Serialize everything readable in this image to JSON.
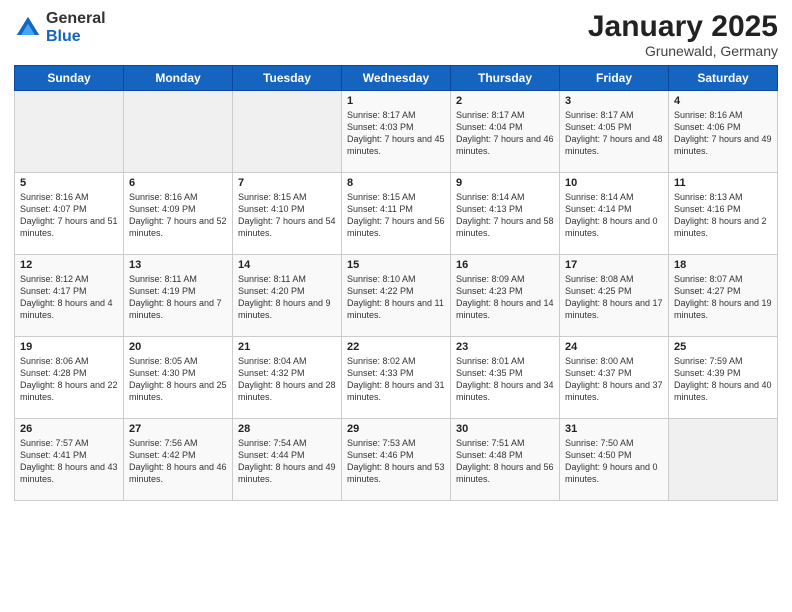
{
  "header": {
    "logo_general": "General",
    "logo_blue": "Blue",
    "month_title": "January 2025",
    "location": "Grunewald, Germany"
  },
  "days_of_week": [
    "Sunday",
    "Monday",
    "Tuesday",
    "Wednesday",
    "Thursday",
    "Friday",
    "Saturday"
  ],
  "weeks": [
    [
      {
        "day": "",
        "content": ""
      },
      {
        "day": "",
        "content": ""
      },
      {
        "day": "",
        "content": ""
      },
      {
        "day": "1",
        "content": "Sunrise: 8:17 AM\nSunset: 4:03 PM\nDaylight: 7 hours and 45 minutes."
      },
      {
        "day": "2",
        "content": "Sunrise: 8:17 AM\nSunset: 4:04 PM\nDaylight: 7 hours and 46 minutes."
      },
      {
        "day": "3",
        "content": "Sunrise: 8:17 AM\nSunset: 4:05 PM\nDaylight: 7 hours and 48 minutes."
      },
      {
        "day": "4",
        "content": "Sunrise: 8:16 AM\nSunset: 4:06 PM\nDaylight: 7 hours and 49 minutes."
      }
    ],
    [
      {
        "day": "5",
        "content": "Sunrise: 8:16 AM\nSunset: 4:07 PM\nDaylight: 7 hours and 51 minutes."
      },
      {
        "day": "6",
        "content": "Sunrise: 8:16 AM\nSunset: 4:09 PM\nDaylight: 7 hours and 52 minutes."
      },
      {
        "day": "7",
        "content": "Sunrise: 8:15 AM\nSunset: 4:10 PM\nDaylight: 7 hours and 54 minutes."
      },
      {
        "day": "8",
        "content": "Sunrise: 8:15 AM\nSunset: 4:11 PM\nDaylight: 7 hours and 56 minutes."
      },
      {
        "day": "9",
        "content": "Sunrise: 8:14 AM\nSunset: 4:13 PM\nDaylight: 7 hours and 58 minutes."
      },
      {
        "day": "10",
        "content": "Sunrise: 8:14 AM\nSunset: 4:14 PM\nDaylight: 8 hours and 0 minutes."
      },
      {
        "day": "11",
        "content": "Sunrise: 8:13 AM\nSunset: 4:16 PM\nDaylight: 8 hours and 2 minutes."
      }
    ],
    [
      {
        "day": "12",
        "content": "Sunrise: 8:12 AM\nSunset: 4:17 PM\nDaylight: 8 hours and 4 minutes."
      },
      {
        "day": "13",
        "content": "Sunrise: 8:11 AM\nSunset: 4:19 PM\nDaylight: 8 hours and 7 minutes."
      },
      {
        "day": "14",
        "content": "Sunrise: 8:11 AM\nSunset: 4:20 PM\nDaylight: 8 hours and 9 minutes."
      },
      {
        "day": "15",
        "content": "Sunrise: 8:10 AM\nSunset: 4:22 PM\nDaylight: 8 hours and 11 minutes."
      },
      {
        "day": "16",
        "content": "Sunrise: 8:09 AM\nSunset: 4:23 PM\nDaylight: 8 hours and 14 minutes."
      },
      {
        "day": "17",
        "content": "Sunrise: 8:08 AM\nSunset: 4:25 PM\nDaylight: 8 hours and 17 minutes."
      },
      {
        "day": "18",
        "content": "Sunrise: 8:07 AM\nSunset: 4:27 PM\nDaylight: 8 hours and 19 minutes."
      }
    ],
    [
      {
        "day": "19",
        "content": "Sunrise: 8:06 AM\nSunset: 4:28 PM\nDaylight: 8 hours and 22 minutes."
      },
      {
        "day": "20",
        "content": "Sunrise: 8:05 AM\nSunset: 4:30 PM\nDaylight: 8 hours and 25 minutes."
      },
      {
        "day": "21",
        "content": "Sunrise: 8:04 AM\nSunset: 4:32 PM\nDaylight: 8 hours and 28 minutes."
      },
      {
        "day": "22",
        "content": "Sunrise: 8:02 AM\nSunset: 4:33 PM\nDaylight: 8 hours and 31 minutes."
      },
      {
        "day": "23",
        "content": "Sunrise: 8:01 AM\nSunset: 4:35 PM\nDaylight: 8 hours and 34 minutes."
      },
      {
        "day": "24",
        "content": "Sunrise: 8:00 AM\nSunset: 4:37 PM\nDaylight: 8 hours and 37 minutes."
      },
      {
        "day": "25",
        "content": "Sunrise: 7:59 AM\nSunset: 4:39 PM\nDaylight: 8 hours and 40 minutes."
      }
    ],
    [
      {
        "day": "26",
        "content": "Sunrise: 7:57 AM\nSunset: 4:41 PM\nDaylight: 8 hours and 43 minutes."
      },
      {
        "day": "27",
        "content": "Sunrise: 7:56 AM\nSunset: 4:42 PM\nDaylight: 8 hours and 46 minutes."
      },
      {
        "day": "28",
        "content": "Sunrise: 7:54 AM\nSunset: 4:44 PM\nDaylight: 8 hours and 49 minutes."
      },
      {
        "day": "29",
        "content": "Sunrise: 7:53 AM\nSunset: 4:46 PM\nDaylight: 8 hours and 53 minutes."
      },
      {
        "day": "30",
        "content": "Sunrise: 7:51 AM\nSunset: 4:48 PM\nDaylight: 8 hours and 56 minutes."
      },
      {
        "day": "31",
        "content": "Sunrise: 7:50 AM\nSunset: 4:50 PM\nDaylight: 9 hours and 0 minutes."
      },
      {
        "day": "",
        "content": ""
      }
    ]
  ]
}
